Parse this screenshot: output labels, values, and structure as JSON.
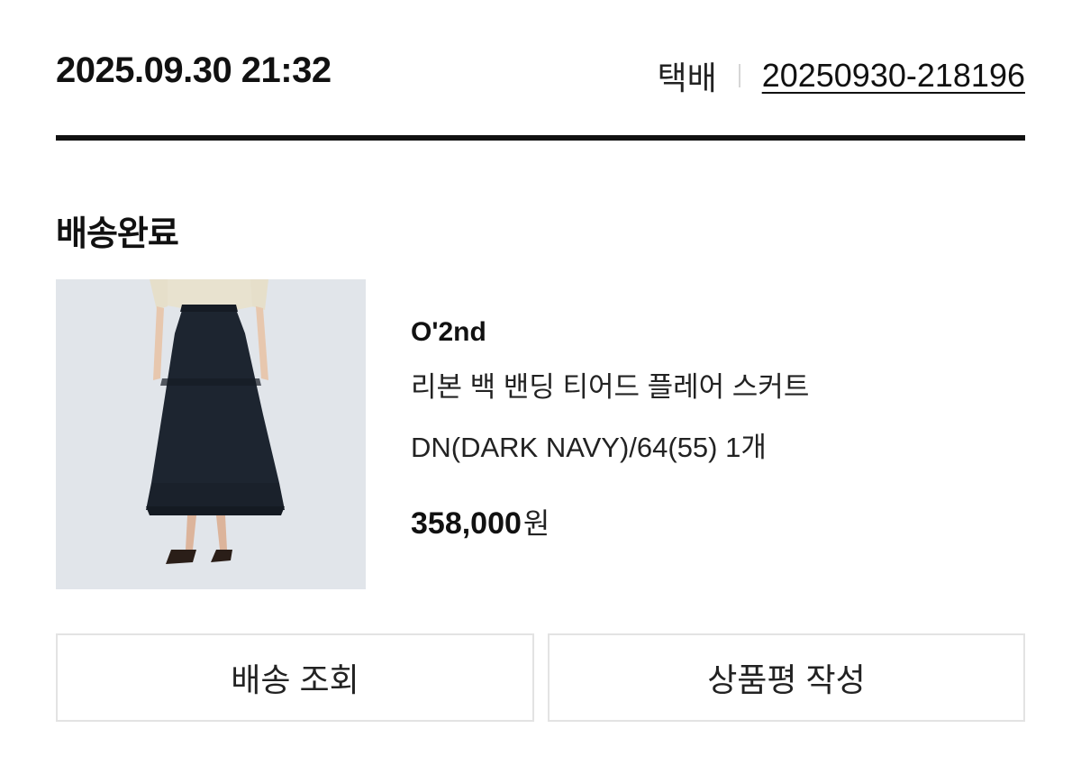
{
  "order": {
    "datetime": "2025.09.30 21:32",
    "shipping_method": "택배",
    "order_number": "20250930-218196"
  },
  "status": "배송완료",
  "product": {
    "image": "product-photo-navy-tiered-skirt",
    "brand": "O'2nd",
    "name": "리본 백 밴딩 티어드 플레어 스커트",
    "option": "DN(DARK NAVY)/64(55)  1개",
    "price": "358,000",
    "currency": "원"
  },
  "buttons": {
    "track": "배송 조회",
    "review": "상품평 작성"
  },
  "colors": {
    "text": "#111111",
    "divider": "#111111",
    "button_border": "#e3e3e3",
    "image_bg": "#dfe3e8",
    "skirt": "#1d2530"
  }
}
